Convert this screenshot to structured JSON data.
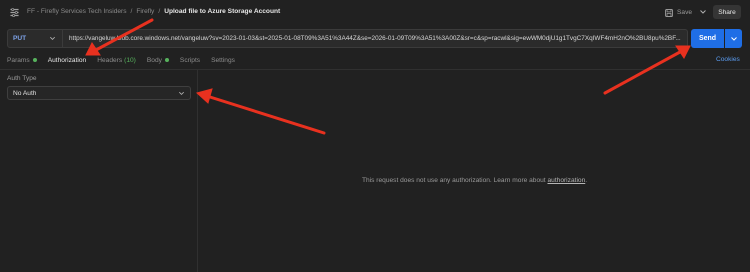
{
  "header": {
    "breadcrumb": [
      "FF - Firefly Services Tech Insiders",
      "/",
      "Firefly",
      "/"
    ],
    "title": "Upload file to Azure Storage Account",
    "save_label": "Save",
    "share_label": "Share"
  },
  "request": {
    "method": "PUT",
    "url": "https://vangeluw.blob.core.windows.net/vangeluw?sv=2023-01-03&st=2025-01-08T09%3A51%3A44Z&se=2026-01-09T09%3A51%3A00Z&sr=c&sp=racwl&sig=ewWM0djU1g1TvgC7XqIWF4mH2nO%2BU8pu%2BF...",
    "send_label": "Send"
  },
  "tabs": [
    {
      "label": "Params",
      "dot": true
    },
    {
      "label": "Authorization",
      "active": true
    },
    {
      "label": "Headers",
      "count": "(10)"
    },
    {
      "label": "Body",
      "dot": true
    },
    {
      "label": "Scripts"
    },
    {
      "label": "Settings"
    }
  ],
  "cookies_label": "Cookies",
  "auth": {
    "label": "Auth Type",
    "value": "No Auth"
  },
  "message": {
    "text": "This request does not use any authorization. Learn more about ",
    "link": "authorization",
    "end": "."
  },
  "colors": {
    "accent": "#ff6c37",
    "send": "#1f6ee6",
    "method": "#7ea3e8",
    "annotation_arrow": "#e8311f"
  },
  "icons": {
    "api": "api-icon",
    "save": "save-icon",
    "chevron": "chevron-down-icon"
  }
}
